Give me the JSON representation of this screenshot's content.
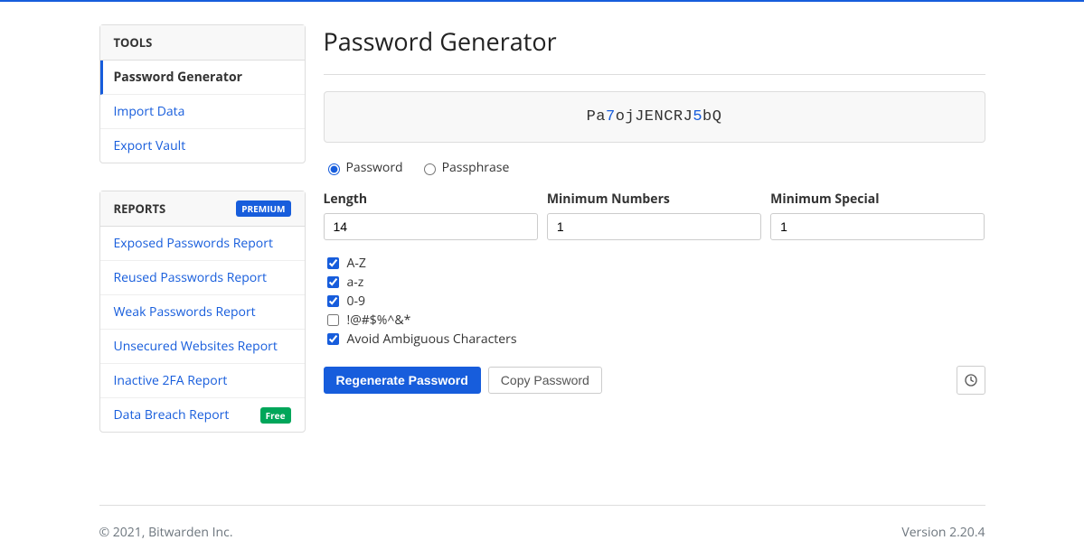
{
  "sidebar": {
    "tools": {
      "header": "Tools",
      "items": [
        {
          "label": "Password Generator",
          "active": true
        },
        {
          "label": "Import Data",
          "active": false
        },
        {
          "label": "Export Vault",
          "active": false
        }
      ]
    },
    "reports": {
      "header": "Reports",
      "badge": "Premium",
      "items": [
        {
          "label": "Exposed Passwords Report"
        },
        {
          "label": "Reused Passwords Report"
        },
        {
          "label": "Weak Passwords Report"
        },
        {
          "label": "Unsecured Websites Report"
        },
        {
          "label": "Inactive 2FA Report"
        },
        {
          "label": "Data Breach Report",
          "badge": "Free"
        }
      ]
    }
  },
  "main": {
    "title": "Password Generator",
    "password_segments": [
      {
        "text": "Pa",
        "type": "letter"
      },
      {
        "text": "7",
        "type": "number"
      },
      {
        "text": "ojJENCRJ",
        "type": "letter"
      },
      {
        "text": "5",
        "type": "number"
      },
      {
        "text": "bQ",
        "type": "letter"
      }
    ],
    "type_options": {
      "password": "Password",
      "passphrase": "Passphrase",
      "selected": "password"
    },
    "fields": {
      "length": {
        "label": "Length",
        "value": "14"
      },
      "min_numbers": {
        "label": "Minimum Numbers",
        "value": "1"
      },
      "min_special": {
        "label": "Minimum Special",
        "value": "1"
      }
    },
    "checks": {
      "uppercase": {
        "label": "A-Z",
        "checked": true
      },
      "lowercase": {
        "label": "a-z",
        "checked": true
      },
      "numbers": {
        "label": "0-9",
        "checked": true
      },
      "special": {
        "label": "!@#$%^&*",
        "checked": false
      },
      "ambiguous": {
        "label": "Avoid Ambiguous Characters",
        "checked": true
      }
    },
    "buttons": {
      "regenerate": "Regenerate Password",
      "copy": "Copy Password"
    }
  },
  "footer": {
    "copyright": "© 2021, Bitwarden Inc.",
    "version": "Version 2.20.4"
  }
}
